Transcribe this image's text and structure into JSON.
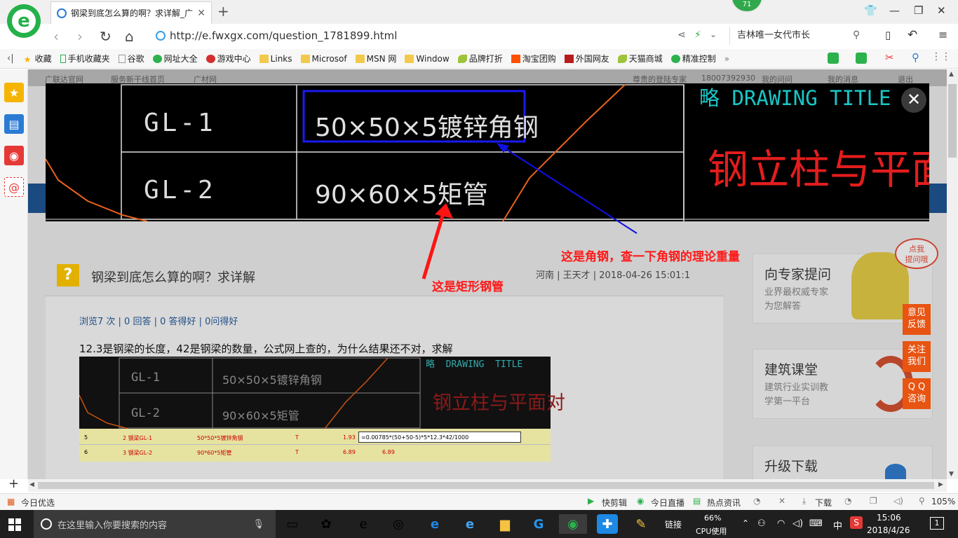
{
  "browser": {
    "tab_title": "钢梁到底怎么算的啊？求详解_广",
    "url": "http://e.fwxgx.com/question_1781899.html",
    "badge": "71",
    "search_text": "吉林唯一女代市长"
  },
  "bookmarks": [
    {
      "label": "收藏",
      "icon": "star-icon"
    },
    {
      "label": "手机收藏夹",
      "icon": "phone-icon"
    },
    {
      "label": "谷歌",
      "icon": "page-icon"
    },
    {
      "label": "网址大全",
      "icon": "globe-icon"
    },
    {
      "label": "游戏中心",
      "icon": "game-icon"
    },
    {
      "label": "Links",
      "icon": "folder-icon"
    },
    {
      "label": "Microsof",
      "icon": "folder-icon"
    },
    {
      "label": "MSN 网",
      "icon": "folder-icon"
    },
    {
      "label": "Window",
      "icon": "folder-icon"
    },
    {
      "label": "品牌打折",
      "icon": "leaf-icon"
    },
    {
      "label": "淘宝团购",
      "icon": "taobao-icon"
    },
    {
      "label": "外国网友",
      "icon": "flag-icon"
    },
    {
      "label": "天猫商城",
      "icon": "leaf-icon"
    },
    {
      "label": "精准控制",
      "icon": "chat-icon"
    }
  ],
  "page": {
    "top_links": [
      "广联达官网",
      "服务新干线首页",
      "广材网"
    ],
    "top_right": [
      "尊贵的登陆专家",
      "18007392930",
      "我的问问",
      "我的消息",
      "退出"
    ],
    "question_title": "钢梁到底怎么算的啊？求详解",
    "question_meta": "河南 | 王天才 | 2018-04-26 15:01:1",
    "stats": "浏览7 次 | 0 回答 | 0 答得好 | 0问得好",
    "body": "12.3是钢梁的长度，42是钢梁的数量，公式网上查的，为什么结果还不对，求解",
    "sidebox1_title": "向专家提问",
    "sidebox1_sub1": "业界最权威专家",
    "sidebox1_sub2": "为您解答",
    "sidebox2_title": "建筑课堂",
    "sidebox2_sub1": "建筑行业实训教",
    "sidebox2_sub2": "学第一平台",
    "sidebox3_title": "升级下载",
    "mascot_bubble": "点我\n提问哦",
    "float_feedback": "意见\n反馈",
    "float_follow": "关注\n我们",
    "float_qq": "Q Q\n咨询"
  },
  "viewer": {
    "row1_label": "GL-1",
    "row1_value": "50×50×5镀锌角钢",
    "row2_label": "GL-2",
    "row2_value": "90×60×5矩管",
    "drawing_title": "略 DRAWING TITLE",
    "red_title": "钢立柱与平面对",
    "annotation_blue": "这是角钢，查一下角钢的理论重量",
    "annotation_red": "这是矩形钢管"
  },
  "thumb": {
    "row1_label": "GL-1",
    "row1_value": "50×50×5镀锌角钢",
    "row2_label": "GL-2",
    "row2_value": "90×60×5矩管",
    "drawing_title": "略  DRAWING  TITLE",
    "red_title": "钢立柱与平面对",
    "sheet_rows": [
      {
        "n": "5",
        "name": "2 钢梁GL-1",
        "spec": "50*50*5镀锌角钢",
        "unit": "T",
        "qty": "1.93",
        "formula": "=0.00785*(50+50-5)*5*12.3*42/1000"
      },
      {
        "n": "6",
        "name": "3 钢梁GL-2",
        "spec": "90*60*5矩管",
        "unit": "T",
        "qty": "6.89",
        "formula": "6.89"
      }
    ]
  },
  "statusbar": {
    "left": "今日优选",
    "items": [
      "快剪辑",
      "今日直播",
      "热点资讯",
      "下载"
    ],
    "zoom": "105%"
  },
  "taskbar": {
    "search_placeholder": "在这里输入你要搜索的内容",
    "links_label": "链接",
    "cpu_percent": "66%",
    "cpu_label": "CPU使用",
    "ime": "中",
    "time": "15:06",
    "date": "2018/4/26",
    "notification_count": "1"
  }
}
